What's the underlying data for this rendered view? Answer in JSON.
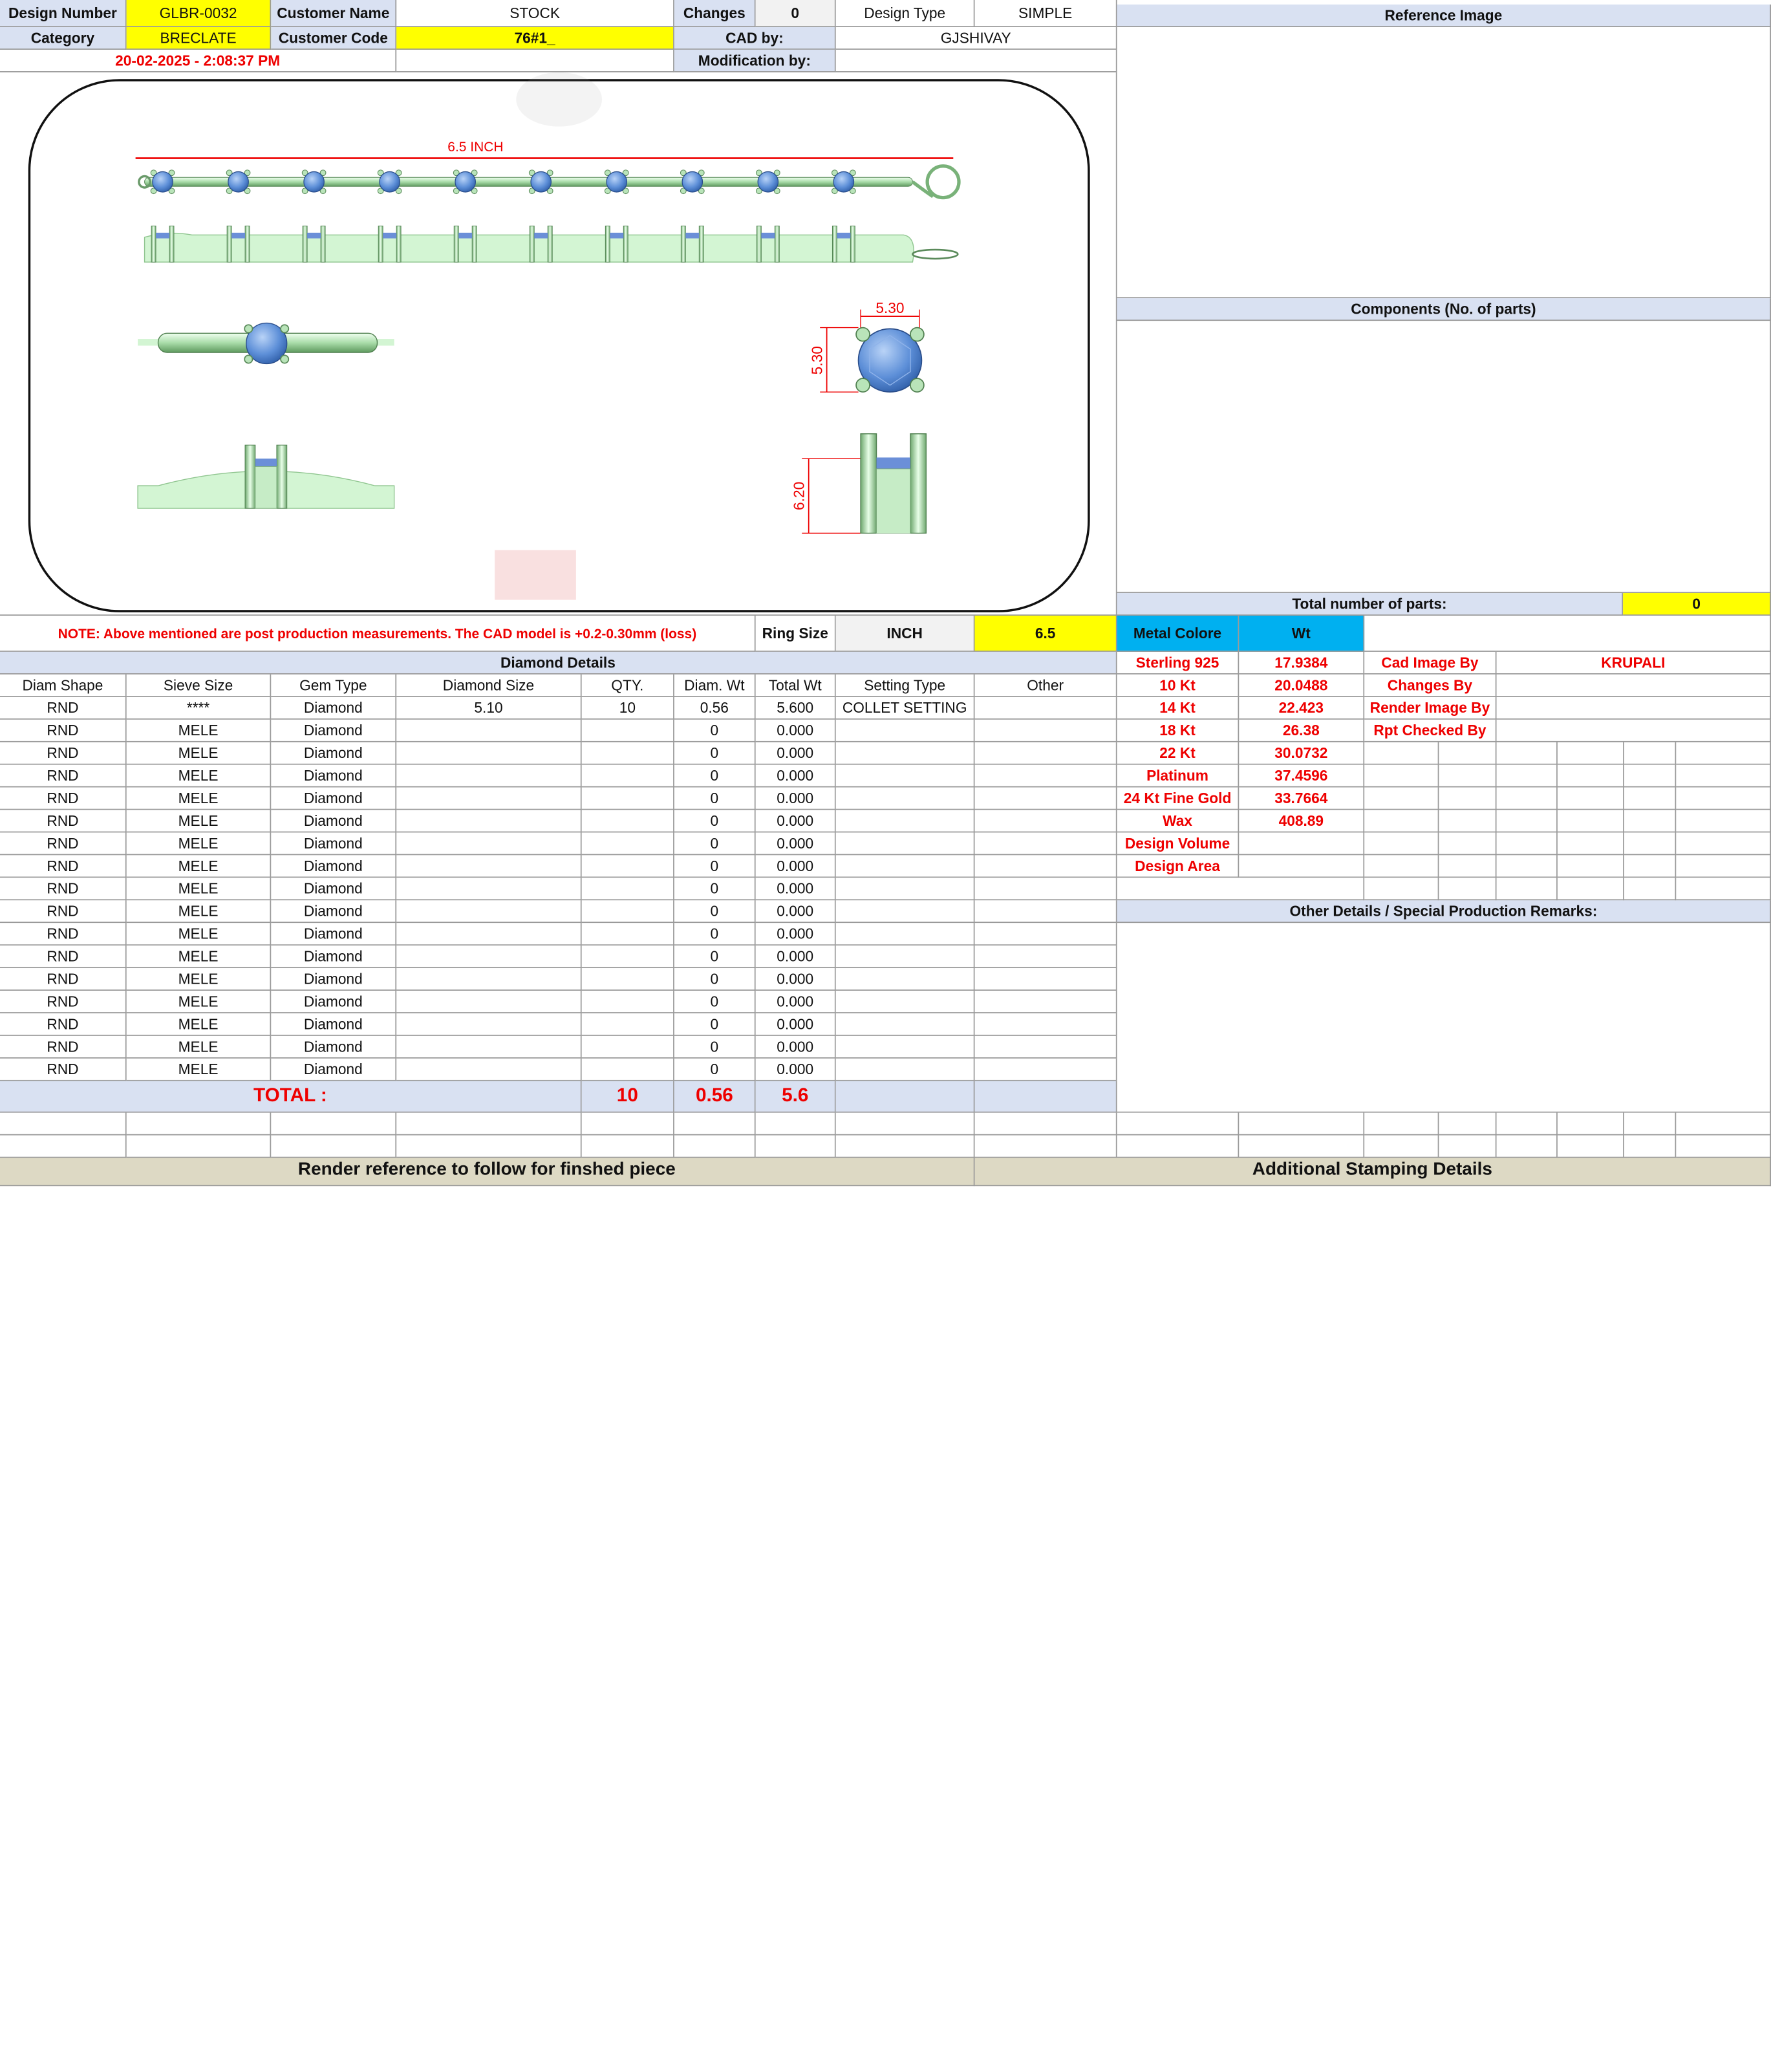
{
  "header": {
    "design_number_label": "Design Number",
    "design_number": "GLBR-0032",
    "customer_name_label": "Customer Name",
    "customer_name": "STOCK",
    "changes_label": "Changes",
    "changes": "0",
    "design_type_label": "Design Type",
    "design_type": "SIMPLE",
    "category_label": "Category",
    "category": "BRECLATE",
    "customer_code_label": "Customer Code",
    "customer_code": "76#1_",
    "cad_by_label": "CAD by:",
    "cad_by": "GJSHIVAY",
    "datetime": "20-02-2025 - 2:08:37 PM",
    "modification_label": "Modification by:"
  },
  "drawing": {
    "length_label": "6.5 INCH",
    "dim_width": "5.30",
    "dim_height": "5.30",
    "dim_depth": "6.20"
  },
  "note": "NOTE: Above mentioned are post production measurements. The CAD model is +0.2-0.30mm (loss)",
  "ring": {
    "label": "Ring Size",
    "unit": "INCH",
    "value": "6.5"
  },
  "diamond_details": {
    "title": "Diamond Details",
    "columns": [
      "Diam Shape",
      "Sieve Size",
      "Gem Type",
      "Diamond Size",
      "QTY.",
      "Diam. Wt",
      "Total Wt",
      "Setting Type",
      "Other"
    ],
    "rows": [
      [
        "RND",
        "****",
        "Diamond",
        "5.10",
        "10",
        "0.56",
        "5.600",
        "COLLET SETTING",
        ""
      ],
      [
        "RND",
        "MELE",
        "Diamond",
        "",
        "",
        "0",
        "0.000",
        "",
        ""
      ],
      [
        "RND",
        "MELE",
        "Diamond",
        "",
        "",
        "0",
        "0.000",
        "",
        ""
      ],
      [
        "RND",
        "MELE",
        "Diamond",
        "",
        "",
        "0",
        "0.000",
        "",
        ""
      ],
      [
        "RND",
        "MELE",
        "Diamond",
        "",
        "",
        "0",
        "0.000",
        "",
        ""
      ],
      [
        "RND",
        "MELE",
        "Diamond",
        "",
        "",
        "0",
        "0.000",
        "",
        ""
      ],
      [
        "RND",
        "MELE",
        "Diamond",
        "",
        "",
        "0",
        "0.000",
        "",
        ""
      ],
      [
        "RND",
        "MELE",
        "Diamond",
        "",
        "",
        "0",
        "0.000",
        "",
        ""
      ],
      [
        "RND",
        "MELE",
        "Diamond",
        "",
        "",
        "0",
        "0.000",
        "",
        ""
      ],
      [
        "RND",
        "MELE",
        "Diamond",
        "",
        "",
        "0",
        "0.000",
        "",
        ""
      ],
      [
        "RND",
        "MELE",
        "Diamond",
        "",
        "",
        "0",
        "0.000",
        "",
        ""
      ],
      [
        "RND",
        "MELE",
        "Diamond",
        "",
        "",
        "0",
        "0.000",
        "",
        ""
      ],
      [
        "RND",
        "MELE",
        "Diamond",
        "",
        "",
        "0",
        "0.000",
        "",
        ""
      ],
      [
        "RND",
        "MELE",
        "Diamond",
        "",
        "",
        "0",
        "0.000",
        "",
        ""
      ],
      [
        "RND",
        "MELE",
        "Diamond",
        "",
        "",
        "0",
        "0.000",
        "",
        ""
      ],
      [
        "RND",
        "MELE",
        "Diamond",
        "",
        "",
        "0",
        "0.000",
        "",
        ""
      ],
      [
        "RND",
        "MELE",
        "Diamond",
        "",
        "",
        "0",
        "0.000",
        "",
        ""
      ]
    ],
    "total_label": "TOTAL :",
    "total_qty": "10",
    "total_diam_wt": "0.56",
    "total_wt": "5.6"
  },
  "reference": {
    "title": "Reference Image",
    "components_title": "Components (No. of parts)",
    "total_parts_label": "Total number of parts:",
    "total_parts": "0"
  },
  "metal": {
    "header_label": "Metal Colore",
    "header_wt": "Wt",
    "rows": [
      [
        "Sterling 925",
        "17.9384"
      ],
      [
        "10 Kt",
        "20.0488"
      ],
      [
        "14 Kt",
        "22.423"
      ],
      [
        "18 Kt",
        "26.38"
      ],
      [
        "22 Kt",
        "30.0732"
      ],
      [
        "Platinum",
        "37.4596"
      ],
      [
        "24 Kt Fine Gold",
        "33.7664"
      ],
      [
        "Wax",
        "408.89"
      ],
      [
        "Design Volume",
        ""
      ],
      [
        "Design Area",
        ""
      ]
    ]
  },
  "credits": {
    "cad_image_by_label": "Cad Image By",
    "cad_image_by": "KRUPALI",
    "changes_by_label": "Changes By",
    "render_image_by_label": "Render Image By",
    "rpt_checked_by_label": "Rpt Checked By"
  },
  "other_details_title": "Other Details / Special Production Remarks:",
  "footer": {
    "render_reference": "Render reference to follow for finshed piece",
    "stamping": "Additional Stamping Details"
  },
  "colors": {
    "label_bg": "#d9e1f2",
    "highlight": "#ffff00",
    "metal_header": "#00b0f0",
    "red_text": "#ee0000",
    "footer_bg": "#ddd9c4"
  }
}
